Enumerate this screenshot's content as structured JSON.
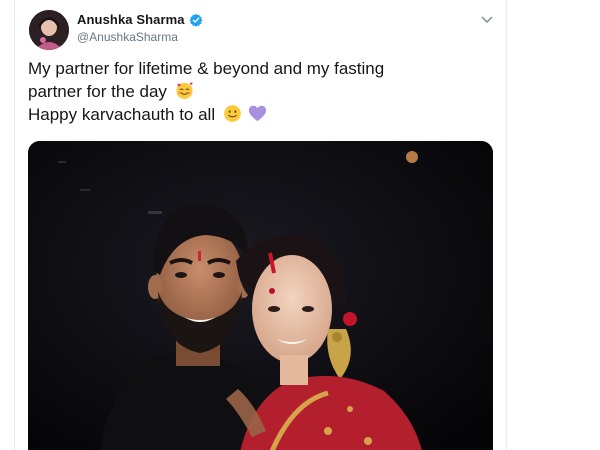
{
  "tweet": {
    "author_name": "Anushka Sharma",
    "author_handle": "@AnushkaSharma",
    "text_line1": "My partner for lifetime & beyond  and my fasting",
    "text_line2": "partner for the day",
    "text_line3": "Happy karvachauth to all",
    "emoji_smiling_hearts": "🥰",
    "emoji_smile": "🙂",
    "emoji_purple_heart": "💜"
  },
  "colors": {
    "verified_badge": "#1da1f2",
    "name_text": "#14171a",
    "handle_text": "#657786",
    "purple_heart": "#a98fe0"
  },
  "icons": {
    "verified": "verified-badge-icon",
    "menu": "chevron-down-icon"
  }
}
